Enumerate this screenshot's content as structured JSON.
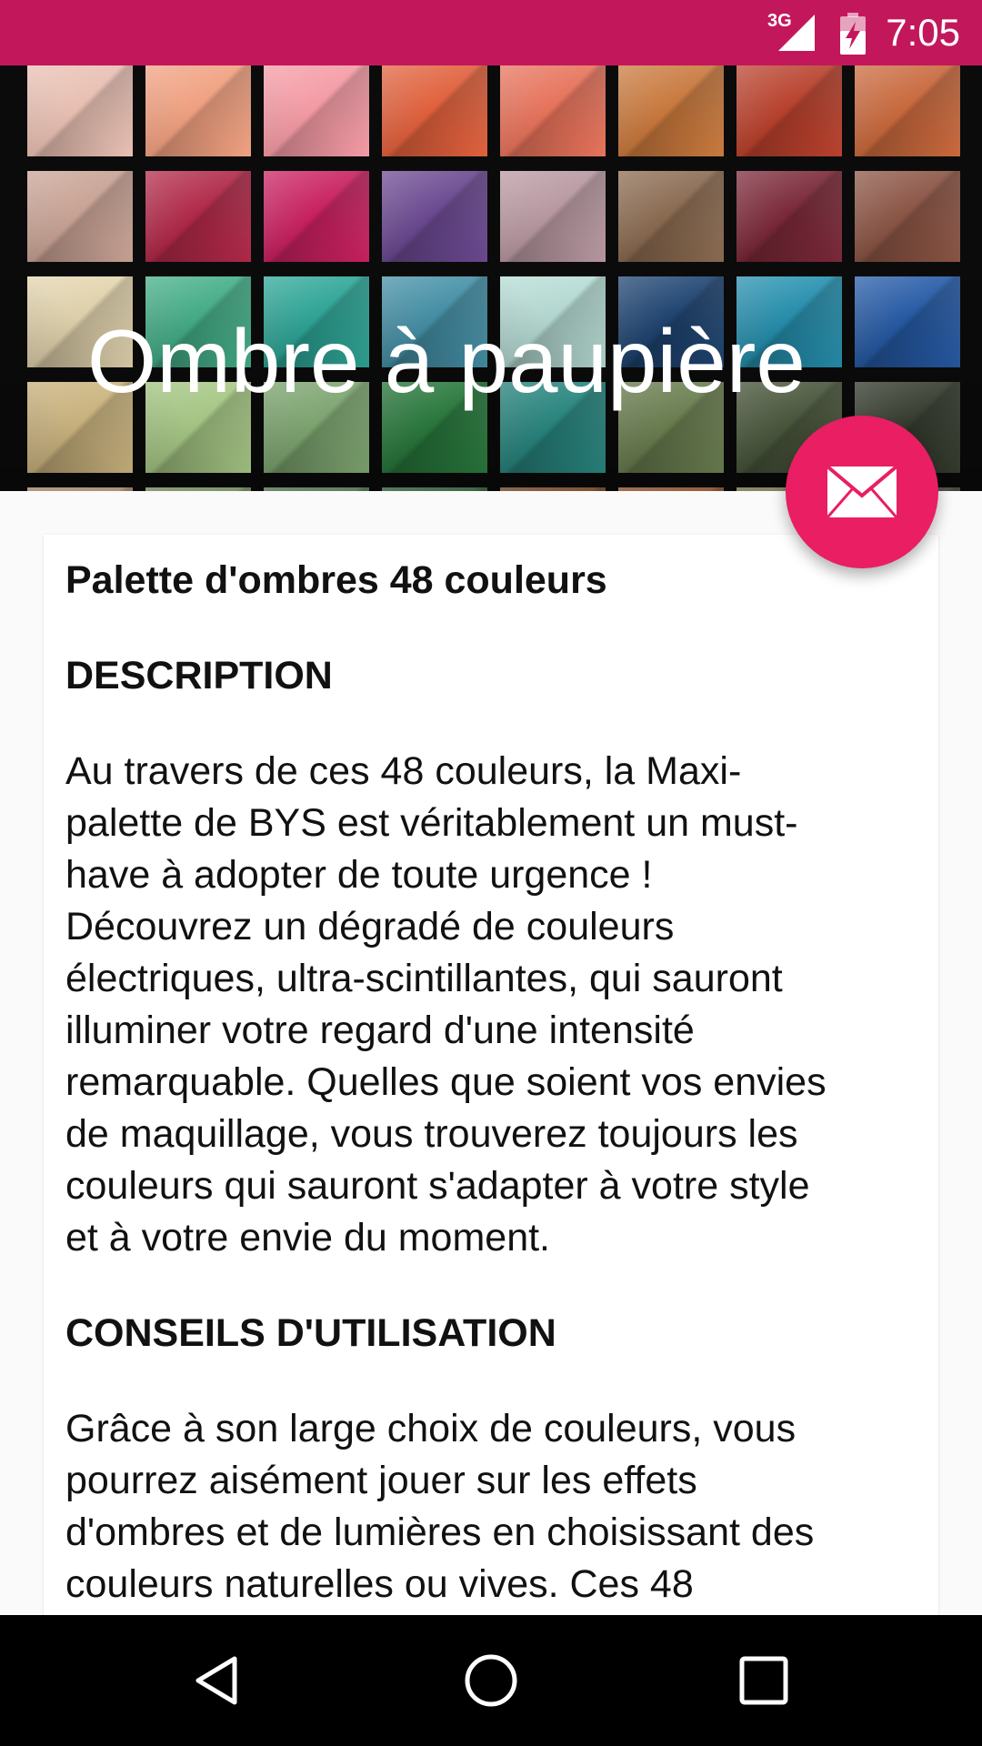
{
  "status_bar": {
    "network_label": "3G",
    "time": "7:05",
    "color": "#c2185b",
    "icons": [
      "cellular-signal-icon",
      "battery-charging-icon"
    ]
  },
  "header": {
    "title": "Ombre à paupière",
    "palette_colors": [
      [
        "#e8bfb2",
        "#f0a080",
        "#f49aa4",
        "#e0603c",
        "#e6725a",
        "#c8783c",
        "#b8402c",
        "#c8683c"
      ],
      [
        "#c8a294",
        "#b02848",
        "#c82060",
        "#6a4890",
        "#b898a0",
        "#8a6a50",
        "#7a2838",
        "#8a5444"
      ],
      [
        "#f0e0b8",
        "#48b890",
        "#30b0a0",
        "#4898b0",
        "#c0e8e0",
        "#204878",
        "#2898b8",
        "#2860b0"
      ],
      [
        "#f4d898",
        "#c8f0a0",
        "#98c888",
        "#309048",
        "#30a098",
        "#809860",
        "#586848",
        "#404838"
      ],
      [
        "#e0c090",
        "#a0c080",
        "#70a070",
        "#408050",
        "#a06030",
        "#c07040",
        "#a0a060",
        "#606050"
      ]
    ]
  },
  "fab": {
    "icon": "mail-icon",
    "color": "#e91e63"
  },
  "content": {
    "product_title": "Palette d'ombres 48 couleurs",
    "description_heading": "DESCRIPTION",
    "description_text": "Au travers de ces 48 couleurs, la Maxi-\npalette de BYS est véritablement un must-\nhave à adopter de toute urgence !\nDécouvrez un dégradé de couleurs\nélectriques, ultra-scintillantes, qui sauront\nilluminer votre regard d'une intensité\nremarquable. Quelles que soient vos envies\nde maquillage, vous trouverez toujours les\ncouleurs qui sauront s'adapter à votre style\net à votre envie du moment.",
    "usage_heading": "CONSEILS D'UTILISATION",
    "usage_text": "Grâce à son large choix de couleurs, vous\npourrez aisément jouer sur les effets\nd'ombres et de lumières en choisissant des\ncouleurs naturelles ou vives. Ces 48"
  },
  "nav_bar": {
    "icons": [
      "back-icon",
      "home-icon",
      "recents-icon"
    ]
  }
}
